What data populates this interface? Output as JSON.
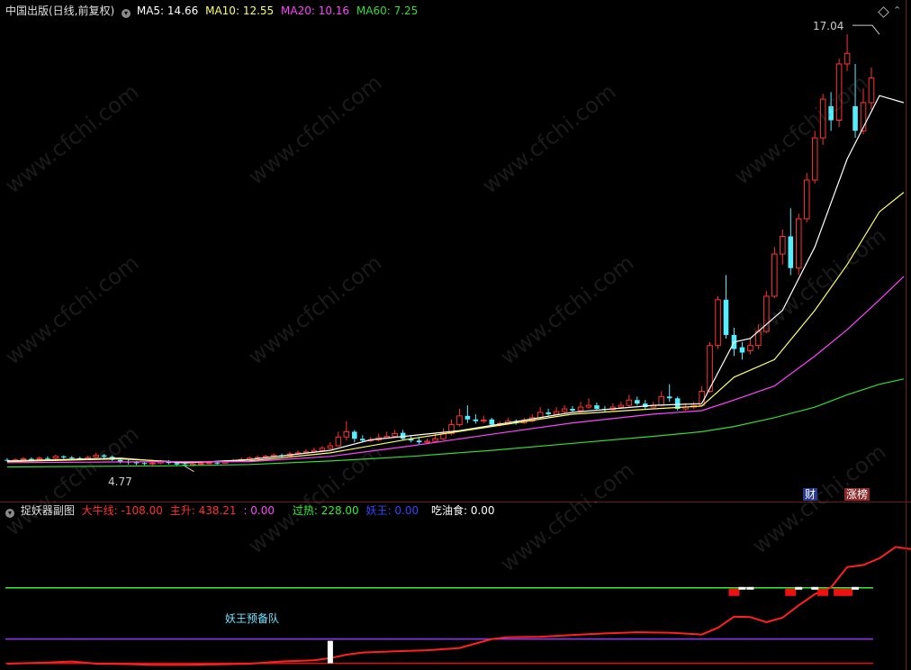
{
  "main_panel": {
    "title": "中国出版(日线,前复权)",
    "ma": [
      {
        "label": "MA5:",
        "value": "14.66",
        "color": "#ffffff"
      },
      {
        "label": "MA10:",
        "value": "12.55",
        "color": "#ffff66"
      },
      {
        "label": "MA20:",
        "value": "10.16",
        "color": "#ff44ff"
      },
      {
        "label": "MA60:",
        "value": "7.25",
        "color": "#33dd33"
      }
    ],
    "high_label": "17.04",
    "low_label": "4.77",
    "badge_cai": "财",
    "badge_zhangbang": "涨榜"
  },
  "sub_panel": {
    "title": "捉妖器副图",
    "items": [
      {
        "label": "大牛线:",
        "value": "-108.00",
        "color": "#ff3030"
      },
      {
        "label": "主升:",
        "value": "438.21",
        "color": "#ff3030"
      },
      {
        "label": ":",
        "value": "0.00",
        "color": "#ff44ff"
      },
      {
        "label": "过热:",
        "value": "228.00",
        "color": "#33ee33"
      },
      {
        "label": "妖王:",
        "value": "0.00",
        "color": "#3344ff"
      },
      {
        "label": "吃油食:",
        "value": "0.00",
        "color": "#ffffff"
      }
    ],
    "annotation": "妖王预备队"
  },
  "watermark": "www.cfchi.com",
  "chart_data": [
    {
      "type": "candlestick",
      "title": "中国出版(日线,前复权)",
      "y_range": [
        4.2,
        17.3
      ],
      "colors": {
        "up": "#ff3333",
        "down": "#55eeff"
      },
      "candles": [
        [
          4.95,
          4.93,
          5.0,
          4.9
        ],
        [
          4.93,
          4.95,
          5.0,
          4.9
        ],
        [
          4.96,
          4.98,
          5.03,
          4.93
        ],
        [
          4.98,
          4.97,
          5.02,
          4.94
        ],
        [
          4.97,
          5.0,
          5.05,
          4.95
        ],
        [
          5.0,
          4.99,
          5.05,
          4.96
        ],
        [
          5.0,
          5.05,
          5.1,
          4.97
        ],
        [
          5.05,
          5.02,
          5.08,
          4.98
        ],
        [
          5.02,
          5.0,
          5.06,
          4.96
        ],
        [
          5.0,
          4.98,
          5.04,
          4.94
        ],
        [
          4.99,
          5.02,
          5.07,
          4.96
        ],
        [
          5.03,
          5.08,
          5.15,
          5.01
        ],
        [
          5.08,
          5.04,
          5.12,
          5.0
        ],
        [
          5.04,
          4.95,
          5.08,
          4.92
        ],
        [
          4.95,
          4.9,
          5.0,
          4.85
        ],
        [
          4.9,
          4.88,
          4.95,
          4.82
        ],
        [
          4.88,
          4.86,
          4.92,
          4.8
        ],
        [
          4.86,
          4.84,
          4.9,
          4.8
        ],
        [
          4.84,
          4.86,
          4.92,
          4.8
        ],
        [
          4.86,
          4.9,
          4.95,
          4.83
        ],
        [
          4.9,
          4.86,
          4.94,
          4.82
        ],
        [
          4.86,
          4.82,
          4.9,
          4.78
        ],
        [
          4.82,
          4.8,
          4.86,
          4.77
        ],
        [
          4.8,
          4.83,
          4.88,
          4.77
        ],
        [
          4.83,
          4.85,
          4.9,
          4.8
        ],
        [
          4.85,
          4.87,
          4.92,
          4.82
        ],
        [
          4.87,
          4.86,
          4.92,
          4.82
        ],
        [
          4.86,
          4.9,
          4.95,
          4.84
        ],
        [
          4.9,
          4.93,
          4.98,
          4.88
        ],
        [
          4.93,
          4.96,
          5.02,
          4.9
        ],
        [
          4.96,
          5.0,
          5.05,
          4.93
        ],
        [
          5.0,
          5.02,
          5.08,
          4.97
        ],
        [
          5.02,
          5.05,
          5.1,
          4.99
        ],
        [
          5.05,
          5.08,
          5.14,
          5.02
        ],
        [
          5.08,
          5.07,
          5.13,
          5.03
        ],
        [
          5.07,
          5.12,
          5.18,
          5.04
        ],
        [
          5.12,
          5.15,
          5.22,
          5.09
        ],
        [
          5.15,
          5.18,
          5.25,
          5.12
        ],
        [
          5.18,
          5.22,
          5.3,
          5.15
        ],
        [
          5.22,
          5.28,
          5.35,
          5.18
        ],
        [
          5.28,
          5.35,
          5.45,
          5.25
        ],
        [
          5.35,
          5.6,
          5.75,
          5.32
        ],
        [
          5.6,
          5.75,
          6.05,
          5.5
        ],
        [
          5.75,
          5.55,
          5.8,
          5.45
        ],
        [
          5.55,
          5.5,
          5.65,
          5.45
        ],
        [
          5.5,
          5.52,
          5.6,
          5.45
        ],
        [
          5.52,
          5.58,
          5.7,
          5.48
        ],
        [
          5.58,
          5.62,
          5.75,
          5.55
        ],
        [
          5.62,
          5.7,
          5.8,
          5.58
        ],
        [
          5.72,
          5.55,
          5.8,
          5.5
        ],
        [
          5.55,
          5.5,
          5.62,
          5.45
        ],
        [
          5.5,
          5.45,
          5.58,
          5.4
        ],
        [
          5.45,
          5.48,
          5.55,
          5.42
        ],
        [
          5.48,
          5.55,
          5.7,
          5.45
        ],
        [
          5.55,
          5.7,
          5.85,
          5.52
        ],
        [
          5.7,
          5.95,
          6.1,
          5.65
        ],
        [
          5.95,
          6.2,
          6.4,
          5.9
        ],
        [
          6.2,
          6.1,
          6.5,
          6.0
        ],
        [
          6.1,
          6.05,
          6.25,
          5.98
        ],
        [
          6.05,
          6.08,
          6.2,
          6.0
        ],
        [
          6.1,
          5.95,
          6.15,
          5.9
        ],
        [
          5.95,
          5.98,
          6.05,
          5.9
        ],
        [
          5.98,
          6.05,
          6.15,
          5.95
        ],
        [
          6.05,
          6.0,
          6.1,
          5.95
        ],
        [
          6.0,
          6.05,
          6.15,
          5.97
        ],
        [
          6.05,
          6.15,
          6.25,
          6.02
        ],
        [
          6.15,
          6.3,
          6.45,
          6.1
        ],
        [
          6.3,
          6.25,
          6.4,
          6.2
        ],
        [
          6.25,
          6.32,
          6.45,
          6.22
        ],
        [
          6.32,
          6.4,
          6.5,
          6.28
        ],
        [
          6.4,
          6.35,
          6.48,
          6.3
        ],
        [
          6.35,
          6.45,
          6.6,
          6.3
        ],
        [
          6.45,
          6.5,
          6.7,
          6.4
        ],
        [
          6.5,
          6.4,
          6.58,
          6.35
        ],
        [
          6.4,
          6.38,
          6.48,
          6.3
        ],
        [
          6.38,
          6.45,
          6.55,
          6.35
        ],
        [
          6.45,
          6.5,
          6.6,
          6.42
        ],
        [
          6.5,
          6.65,
          6.8,
          6.45
        ],
        [
          6.65,
          6.55,
          6.75,
          6.5
        ],
        [
          6.55,
          6.45,
          6.65,
          6.4
        ],
        [
          6.45,
          6.5,
          6.6,
          6.42
        ],
        [
          6.5,
          6.75,
          6.9,
          6.48
        ],
        [
          6.75,
          6.7,
          7.1,
          6.6
        ],
        [
          6.7,
          6.4,
          6.75,
          6.35
        ],
        [
          6.4,
          6.45,
          6.55,
          6.35
        ],
        [
          6.45,
          6.5,
          6.6,
          6.4
        ],
        [
          6.5,
          6.9,
          7.05,
          6.48
        ],
        [
          6.9,
          8.2,
          8.3,
          6.85
        ],
        [
          8.2,
          9.5,
          9.6,
          8.1
        ],
        [
          9.5,
          8.5,
          10.2,
          8.4
        ],
        [
          8.5,
          8.1,
          8.7,
          7.9
        ],
        [
          8.15,
          8.0,
          8.3,
          7.8
        ],
        [
          8.05,
          8.2,
          8.4,
          7.95
        ],
        [
          8.2,
          8.6,
          8.8,
          8.1
        ],
        [
          8.6,
          9.6,
          9.75,
          8.55
        ],
        [
          9.6,
          10.8,
          11.0,
          9.55
        ],
        [
          10.8,
          11.3,
          11.5,
          10.5
        ],
        [
          11.3,
          10.4,
          12.1,
          10.2
        ],
        [
          10.4,
          11.8,
          11.95,
          10.2
        ],
        [
          11.8,
          12.9,
          13.1,
          11.7
        ],
        [
          12.9,
          14.1,
          14.3,
          12.8
        ],
        [
          14.1,
          15.2,
          15.35,
          13.9
        ],
        [
          15.0,
          14.6,
          15.4,
          14.3
        ],
        [
          14.6,
          16.2,
          16.35,
          14.4
        ],
        [
          16.2,
          16.5,
          17.04,
          16.0
        ],
        [
          15.0,
          14.3,
          16.2,
          14.1
        ],
        [
          14.3,
          15.1,
          15.5,
          14.2
        ],
        [
          15.1,
          15.8,
          16.1,
          14.9
        ]
      ],
      "ma_series": [
        {
          "name": "MA5",
          "color": "#ffffff",
          "points": [
            [
              0,
              4.92
            ],
            [
              14,
              5.0
            ],
            [
              22,
              4.86
            ],
            [
              30,
              4.96
            ],
            [
              40,
              5.22
            ],
            [
              45,
              5.52
            ],
            [
              56,
              5.78
            ],
            [
              70,
              6.3
            ],
            [
              80,
              6.5
            ],
            [
              86,
              6.55
            ],
            [
              90,
              8.3
            ],
            [
              92,
              8.4
            ],
            [
              96,
              9.2
            ],
            [
              100,
              11.0
            ],
            [
              104,
              13.5
            ],
            [
              108,
              15.3
            ],
            [
              111,
              15.1
            ]
          ]
        },
        {
          "name": "MA10",
          "color": "#ffff66",
          "points": [
            [
              0,
              4.9
            ],
            [
              14,
              4.98
            ],
            [
              22,
              4.88
            ],
            [
              30,
              4.92
            ],
            [
              40,
              5.15
            ],
            [
              50,
              5.55
            ],
            [
              60,
              5.9
            ],
            [
              70,
              6.25
            ],
            [
              80,
              6.4
            ],
            [
              86,
              6.48
            ],
            [
              90,
              7.3
            ],
            [
              95,
              7.8
            ],
            [
              100,
              9.2
            ],
            [
              104,
              10.5
            ],
            [
              108,
              12.0
            ],
            [
              111,
              12.55
            ]
          ]
        },
        {
          "name": "MA20",
          "color": "#ff44ff",
          "points": [
            [
              0,
              4.87
            ],
            [
              20,
              4.9
            ],
            [
              30,
              4.9
            ],
            [
              40,
              5.05
            ],
            [
              50,
              5.35
            ],
            [
              60,
              5.68
            ],
            [
              70,
              6.0
            ],
            [
              80,
              6.25
            ],
            [
              86,
              6.35
            ],
            [
              90,
              6.65
            ],
            [
              95,
              7.05
            ],
            [
              100,
              7.9
            ],
            [
              104,
              8.65
            ],
            [
              108,
              9.5
            ],
            [
              111,
              10.16
            ]
          ]
        },
        {
          "name": "MA60",
          "color": "#33dd33",
          "points": [
            [
              0,
              4.75
            ],
            [
              20,
              4.78
            ],
            [
              30,
              4.82
            ],
            [
              40,
              4.92
            ],
            [
              50,
              5.05
            ],
            [
              60,
              5.22
            ],
            [
              70,
              5.42
            ],
            [
              80,
              5.62
            ],
            [
              86,
              5.75
            ],
            [
              90,
              5.9
            ],
            [
              95,
              6.15
            ],
            [
              100,
              6.45
            ],
            [
              104,
              6.8
            ],
            [
              108,
              7.1
            ],
            [
              111,
              7.25
            ]
          ]
        }
      ]
    },
    {
      "type": "line",
      "title": "捉妖器副图",
      "y_range": [
        -130,
        520
      ],
      "reference_lines": [
        {
          "name": "过热",
          "value": 228,
          "color": "#33ee33"
        },
        {
          "name": "",
          "value": 0,
          "color": "#9933ff"
        },
        {
          "name": "大牛线",
          "value": -108,
          "color": "#dd1111"
        }
      ],
      "series": [
        {
          "name": "主升",
          "color": "#ff2020",
          "points": [
            [
              0,
              -110
            ],
            [
              5,
              -105
            ],
            [
              8,
              -100
            ],
            [
              11,
              -110
            ],
            [
              15,
              -112
            ],
            [
              18,
              -115
            ],
            [
              22,
              -115
            ],
            [
              26,
              -113
            ],
            [
              30,
              -110
            ],
            [
              34,
              -100
            ],
            [
              38,
              -95
            ],
            [
              40,
              -85
            ],
            [
              42,
              -70
            ],
            [
              44,
              -60
            ],
            [
              48,
              -55
            ],
            [
              52,
              -50
            ],
            [
              56,
              -40
            ],
            [
              58,
              -20
            ],
            [
              60,
              0
            ],
            [
              62,
              8
            ],
            [
              66,
              10
            ],
            [
              70,
              18
            ],
            [
              74,
              25
            ],
            [
              78,
              30
            ],
            [
              82,
              28
            ],
            [
              86,
              20
            ],
            [
              88,
              50
            ],
            [
              90,
              100
            ],
            [
              92,
              98
            ],
            [
              94,
              75
            ],
            [
              96,
              95
            ],
            [
              98,
              150
            ],
            [
              100,
              200
            ],
            [
              102,
              230
            ],
            [
              104,
              320
            ],
            [
              106,
              330
            ],
            [
              108,
              360
            ],
            [
              110,
              410
            ],
            [
              112,
              400
            ]
          ]
        }
      ],
      "signals": {
        "red_blocks": [
          90,
          97,
          101,
          103,
          104
        ],
        "white_marks": [
          91,
          92,
          98,
          100,
          105
        ],
        "yaowang_bar": 40
      }
    }
  ]
}
